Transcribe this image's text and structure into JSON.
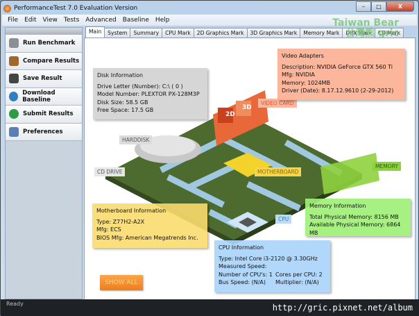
{
  "window": {
    "title": "PerformanceTest 7.0 Evaluation Version",
    "minimize": "–",
    "maximize": "□",
    "close": "X"
  },
  "menu": [
    "File",
    "Edit",
    "View",
    "Tests",
    "Advanced",
    "Baseline",
    "Help"
  ],
  "watermark": {
    "line1": "Taiwan Bear",
    "line2": "台灣熊 gric"
  },
  "sidebar": [
    {
      "label": "Run Benchmark",
      "icon": "benchmark-icon",
      "color": "#8a8f96"
    },
    {
      "label": "Compare Results",
      "icon": "scale-icon",
      "color": "#a0692b"
    },
    {
      "label": "Save Result",
      "icon": "save-icon",
      "color": "#444444"
    },
    {
      "label": "Download Baseline",
      "icon": "globe-download-icon",
      "color": "#2f7fc2"
    },
    {
      "label": "Submit Results",
      "icon": "globe-upload-icon",
      "color": "#2f9a44"
    },
    {
      "label": "Preferences",
      "icon": "preferences-icon",
      "color": "#5a7fb5"
    }
  ],
  "tabs": [
    "Main",
    "System",
    "Summary",
    "CPU Mark",
    "2D Graphics Mark",
    "3D Graphics Mark",
    "Memory Mark",
    "Disk Mark",
    "CD Mark"
  ],
  "active_tab": "Main",
  "diagram": {
    "harddisk": "HARDDISK",
    "cddrive": "CD DRIVE",
    "videocard": "VIDEO CARD",
    "motherboard": "MOTHERBOARD",
    "memory": "MEMORY",
    "cpu": "CPU",
    "card2d": "2D",
    "card3d": "3D"
  },
  "disk": {
    "title": "Disk Information",
    "lines": [
      "Drive Letter (Number): C:\\ ( 0 )",
      "Model Number: PLEXTOR PX-128M3P",
      "Disk Size: 58.5 GB",
      "Free Space: 17.5 GB"
    ]
  },
  "video": {
    "title": "Video Adapters",
    "lines": [
      "Description: NVIDIA GeForce GTX 560 Ti",
      "Mfg: NVIDIA",
      "Memory: 1024MB",
      "Driver (Date): 8.17.12.9610 (2-29-2012)"
    ]
  },
  "motherboard": {
    "title": "Motherboard Information",
    "lines": [
      "Type: Z77H2-A2X",
      "Mfg: ECS",
      "BIOS Mfg: American Megatrends Inc."
    ]
  },
  "memory": {
    "title": "Memory Information",
    "lines": [
      "Total Physical Memory: 8156 MB",
      "Available Physical Memory: 6864 MB"
    ]
  },
  "cpu": {
    "title": "CPU Information",
    "lines": [
      "Type: Intel Core i3-2120 @ 3.30GHz",
      "Measured Speed:"
    ],
    "grid": [
      "Number of CPU's: 1",
      "Cores per CPU: 2",
      "Bus Speed: (N/A)",
      "Multiplier: (N/A)"
    ]
  },
  "show_all": "SHOW ALL",
  "status": "Ready",
  "url_watermark": "http://gric.pixnet.net/album"
}
